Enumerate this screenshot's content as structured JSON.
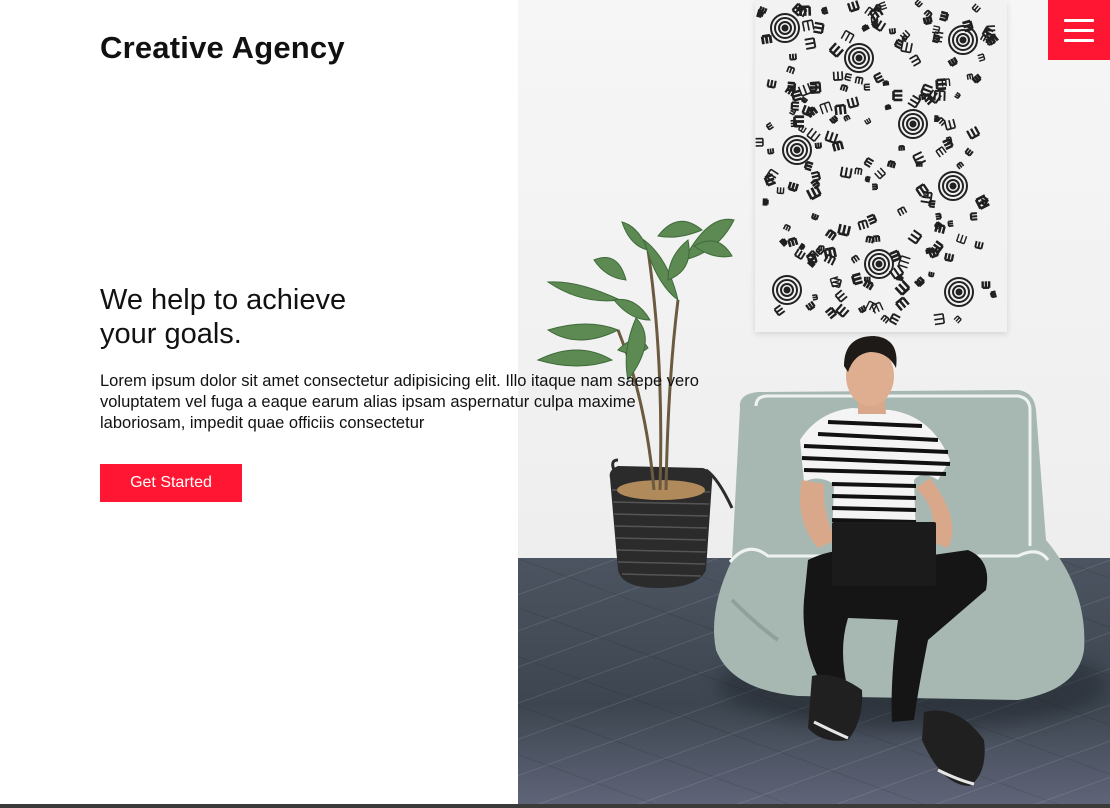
{
  "header": {
    "logo_text": "Creative Agency",
    "menu_icon": "hamburger-menu-icon"
  },
  "hero": {
    "headline_line1": "We help to achieve",
    "headline_line2": "your goals.",
    "lead": "Lorem ipsum dolor sit amet consectetur adipisicing elit. Illo itaque nam saepe vero voluptatem vel fuga a eaque earum alias ipsam aspernatur culpa maxime laboriosam, impedit quae officiis consectetur",
    "cta_label": "Get Started"
  },
  "colors": {
    "accent": "#ff1632",
    "text": "#111111",
    "background": "#ffffff"
  }
}
